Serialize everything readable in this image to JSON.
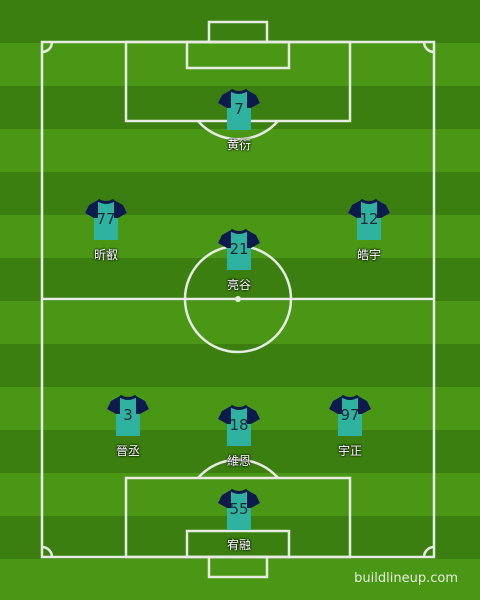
{
  "colors": {
    "grass_dark": "#3a7f10",
    "grass_light": "#4a9716",
    "lines": "#e6ece2",
    "shirt_body": "#2fb2a0",
    "shirt_sleeve": "#0d1b4c"
  },
  "players": [
    {
      "number": "7",
      "name": "黄衍"
    },
    {
      "number": "77",
      "name": "昕叡"
    },
    {
      "number": "21",
      "name": "亮谷"
    },
    {
      "number": "12",
      "name": "皓宇"
    },
    {
      "number": "3",
      "name": "晉丞"
    },
    {
      "number": "18",
      "name": "維恩"
    },
    {
      "number": "97",
      "name": "宇正"
    },
    {
      "number": "55",
      "name": "宥融"
    }
  ],
  "watermark": "buildlineup.com"
}
